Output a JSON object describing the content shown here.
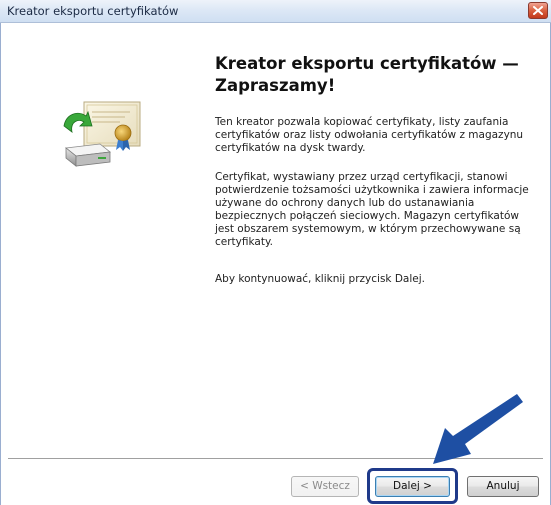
{
  "window": {
    "title": "Kreator eksportu certyfikatów"
  },
  "icons": {
    "close": "close-icon",
    "wizard": "certificate-export-icon",
    "pointer": "pointer-arrow"
  },
  "main": {
    "heading": "Kreator eksportu certyfikatów — Zapraszamy!",
    "paragraph1": "Ten kreator pozwala kopiować certyfikaty, listy zaufania certyfikatów oraz listy odwołania certyfikatów z magazynu certyfikatów na dysk twardy.",
    "paragraph2": "Certyfikat, wystawiany przez urząd certyfikacji, stanowi potwierdzenie tożsamości użytkownika i zawiera informacje używane do ochrony danych lub do ustanawiania bezpiecznych połączeń sieciowych. Magazyn certyfikatów jest obszarem systemowym, w którym przechowywane są certyfikaty.",
    "paragraph3": "Aby kontynuować, kliknij przycisk Dalej."
  },
  "footer": {
    "back_label": "< Wstecz",
    "next_label": "Dalej >",
    "cancel_label": "Anuluj"
  },
  "colors": {
    "highlight": "#1f3a8a",
    "arrow": "#1e4fa3"
  }
}
